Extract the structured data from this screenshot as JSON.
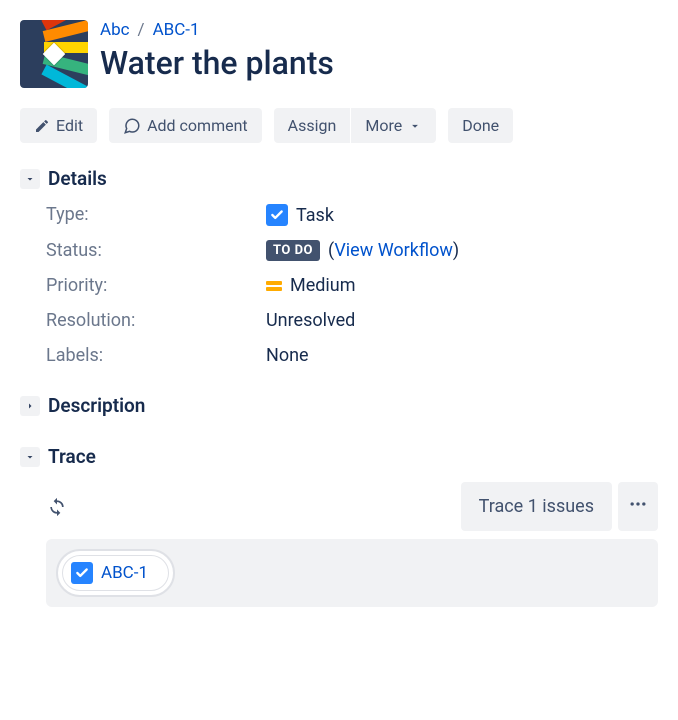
{
  "breadcrumb": {
    "project": "Abc",
    "issue_key": "ABC-1"
  },
  "title": "Water the plants",
  "toolbar": {
    "edit": "Edit",
    "add_comment": "Add comment",
    "assign": "Assign",
    "more": "More",
    "done": "Done"
  },
  "sections": {
    "details": "Details",
    "description": "Description",
    "trace": "Trace"
  },
  "details": {
    "type_label": "Type:",
    "type_value": "Task",
    "status_label": "Status:",
    "status_lozenge": "TO DO",
    "status_workflow_link": "View Workflow",
    "priority_label": "Priority:",
    "priority_value": "Medium",
    "resolution_label": "Resolution:",
    "resolution_value": "Unresolved",
    "labels_label": "Labels:",
    "labels_value": "None"
  },
  "trace": {
    "summary": "Trace 1 issues",
    "chip_key": "ABC-1"
  }
}
